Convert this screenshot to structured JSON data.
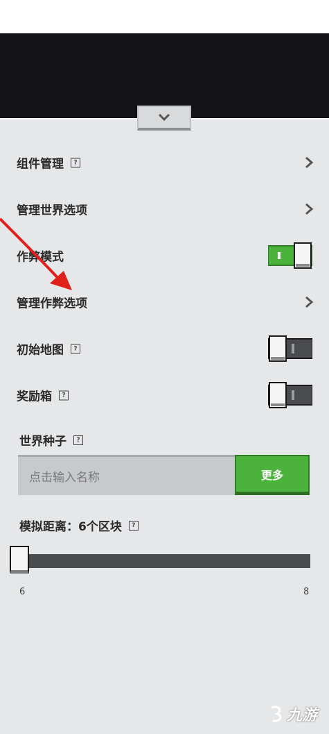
{
  "settings": {
    "rows": [
      {
        "label": "组件管理",
        "help": true,
        "control": "chevron"
      },
      {
        "label": "管理世界选项",
        "help": false,
        "control": "chevron"
      },
      {
        "label": "作弊模式",
        "help": false,
        "control": "toggle",
        "on": true
      },
      {
        "label": "管理作弊选项",
        "help": false,
        "control": "chevron"
      },
      {
        "label": "初始地图",
        "help": true,
        "control": "toggle",
        "on": false
      },
      {
        "label": "奖励箱",
        "help": true,
        "control": "toggle",
        "on": false
      }
    ],
    "help_glyph": "?"
  },
  "seed": {
    "label": "世界种子",
    "placeholder": "点击输入名称",
    "more_button": "更多"
  },
  "sim_distance": {
    "label": "模拟距离：6个区块",
    "min": "6",
    "max": "8",
    "value_fraction": 0.0
  },
  "watermark": {
    "text": "九游"
  },
  "colors": {
    "panel_bg": "#e5e7e9",
    "toggle_on": "#4bb33b",
    "toggle_off": "#4a4b4f",
    "button_green": "#4bb33b",
    "annotation_arrow": "#e0201a"
  }
}
